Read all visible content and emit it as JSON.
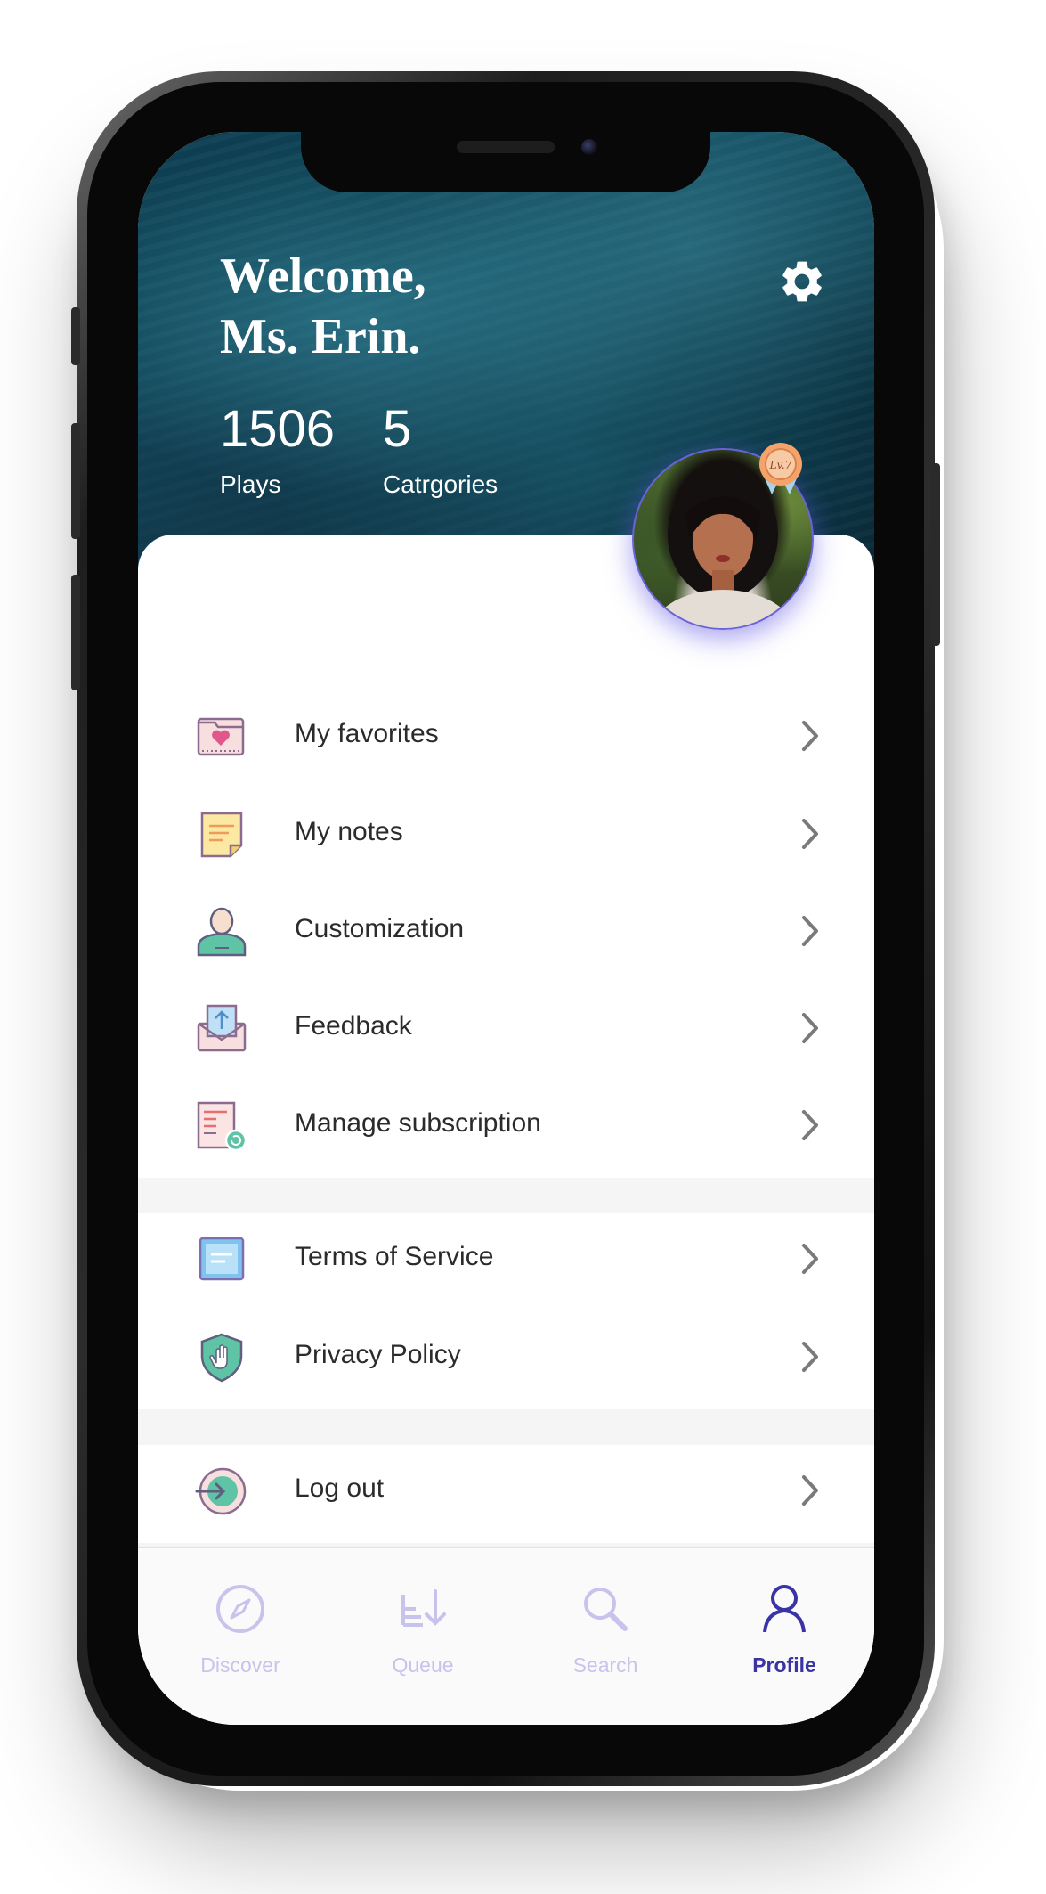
{
  "header": {
    "welcome_line1": "Welcome,",
    "welcome_line2": "Ms. Erin.",
    "stats": [
      {
        "value": "1506",
        "label": "Plays"
      },
      {
        "value": "5",
        "label": "Catrgories"
      }
    ],
    "level_badge": "Lv.7"
  },
  "menu": {
    "group1": [
      {
        "label": "My favorites",
        "icon": "favorites-folder-icon"
      },
      {
        "label": "My notes",
        "icon": "notes-icon"
      },
      {
        "label": "Customization",
        "icon": "user-customization-icon"
      },
      {
        "label": "Feedback",
        "icon": "feedback-envelope-icon"
      },
      {
        "label": "Manage subscription",
        "icon": "subscription-icon"
      }
    ],
    "group2": [
      {
        "label": "Terms of Service",
        "icon": "terms-icon"
      },
      {
        "label": "Privacy Policy",
        "icon": "privacy-shield-icon"
      }
    ],
    "group3": [
      {
        "label": "Log out",
        "icon": "logout-icon"
      }
    ]
  },
  "tabbar": {
    "tabs": [
      {
        "label": "Discover",
        "icon": "compass-icon",
        "active": false
      },
      {
        "label": "Queue",
        "icon": "queue-icon",
        "active": false
      },
      {
        "label": "Search",
        "icon": "search-icon",
        "active": false
      },
      {
        "label": "Profile",
        "icon": "profile-icon",
        "active": true
      }
    ]
  },
  "colors": {
    "accent": "#3a33a6",
    "inactive_tab": "#c8c3ec",
    "header_bg": "#0e3f52"
  }
}
